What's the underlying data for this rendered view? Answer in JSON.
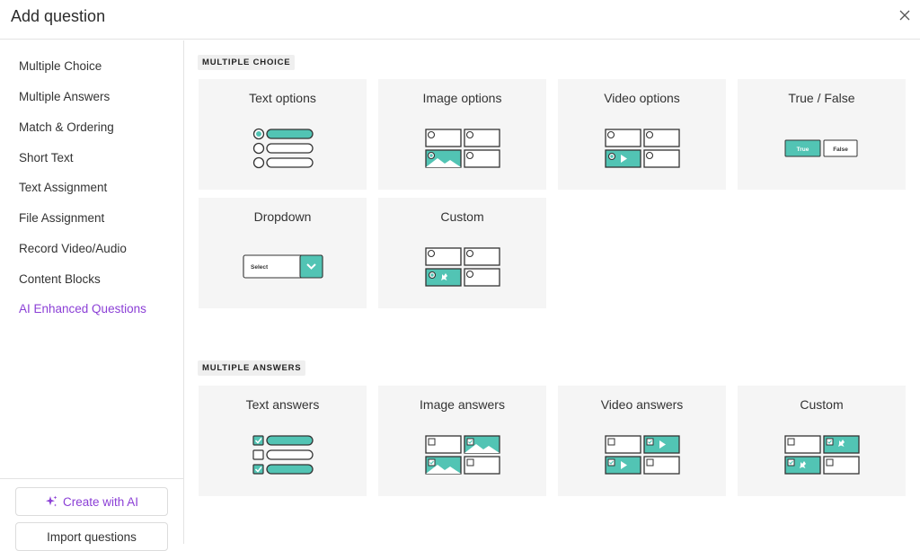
{
  "header": {
    "title": "Add question",
    "close_icon": "close-icon"
  },
  "sidebar": {
    "items": [
      {
        "label": "Multiple Choice"
      },
      {
        "label": "Multiple Answers"
      },
      {
        "label": "Match & Ordering"
      },
      {
        "label": "Short Text"
      },
      {
        "label": "Text Assignment"
      },
      {
        "label": "File Assignment"
      },
      {
        "label": "Record Video/Audio"
      },
      {
        "label": "Content Blocks"
      },
      {
        "label": "AI Enhanced Questions"
      }
    ],
    "create_ai_label": "Create with AI",
    "create_ai_icon": "sparkle-icon",
    "import_label": "Import questions"
  },
  "sections": [
    {
      "label": "MULTIPLE CHOICE",
      "cards": [
        {
          "title": "Text options",
          "icon": "text-options-illustration"
        },
        {
          "title": "Image options",
          "icon": "image-options-illustration"
        },
        {
          "title": "Video options",
          "icon": "video-options-illustration"
        },
        {
          "title": "True / False",
          "icon": "true-false-illustration",
          "true_label": "True",
          "false_label": "False"
        },
        {
          "title": "Dropdown",
          "icon": "dropdown-illustration",
          "select_label": "Select"
        },
        {
          "title": "Custom",
          "icon": "custom-options-illustration"
        }
      ]
    },
    {
      "label": "MULTIPLE ANSWERS",
      "cards": [
        {
          "title": "Text answers",
          "icon": "text-answers-illustration"
        },
        {
          "title": "Image answers",
          "icon": "image-answers-illustration"
        },
        {
          "title": "Video answers",
          "icon": "video-answers-illustration"
        },
        {
          "title": "Custom",
          "icon": "custom-answers-illustration"
        }
      ]
    }
  ],
  "colors": {
    "accent": "#52c4b4",
    "ai": "#8b3fd6",
    "card_bg": "#f5f5f5",
    "outline": "#333333"
  }
}
